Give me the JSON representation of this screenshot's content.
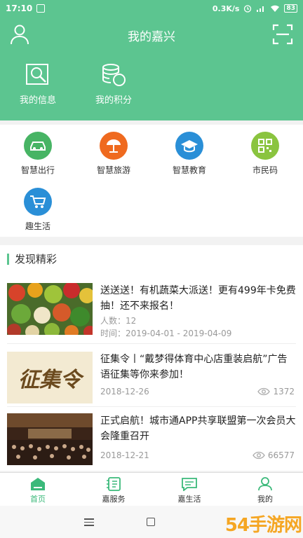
{
  "status_bar": {
    "time": "17:10",
    "network_speed": "0.3K/s",
    "battery": "83"
  },
  "header": {
    "title": "我的嘉兴",
    "items": [
      {
        "label": "我的信息",
        "icon": "search-document-icon"
      },
      {
        "label": "我的积分",
        "icon": "coins-icon"
      }
    ]
  },
  "services": [
    {
      "label": "智慧出行",
      "icon": "car-icon",
      "color": "#47b464"
    },
    {
      "label": "智慧旅游",
      "icon": "beach-umbrella-icon",
      "color": "#ef6a1f"
    },
    {
      "label": "智慧教育",
      "icon": "graduation-cap-icon",
      "color": "#2a8fd7"
    },
    {
      "label": "市民码",
      "icon": "qr-code-icon",
      "color": "#8ac43f"
    },
    {
      "label": "趣生活",
      "icon": "shopping-cart-icon",
      "color": "#2a8fd7"
    }
  ],
  "discover": {
    "title": "发现精彩",
    "articles": [
      {
        "title": "送送送！有机蔬菜大派送！更有499年卡免费抽！还不来报名！",
        "people": "人数：12",
        "time": "时间：2019-04-01 - 2019-04-09"
      },
      {
        "title": "征集令丨“戴梦得体育中心店重装启航”广告语征集等你来参加！",
        "date": "2018-12-26",
        "views": "1372",
        "thumb_text": "征集令"
      },
      {
        "title": "正式启航！城市通APP共享联盟第一次会员大会隆重召开",
        "date": "2018-12-21",
        "views": "66577"
      }
    ]
  },
  "tabs": [
    {
      "label": "首页",
      "icon": "home-icon",
      "active": true
    },
    {
      "label": "嘉服务",
      "icon": "service-list-icon",
      "active": false
    },
    {
      "label": "嘉生活",
      "icon": "chat-icon",
      "active": false
    },
    {
      "label": "我的",
      "icon": "profile-icon",
      "active": false
    }
  ],
  "watermark": "54手游网",
  "colors": {
    "primary": "#5cc590",
    "tab_active": "#3bb97a"
  }
}
